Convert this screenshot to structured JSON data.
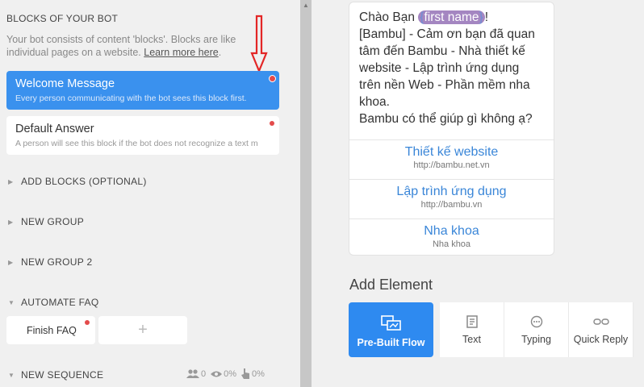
{
  "sidebar": {
    "title": "BLOCKS OF YOUR BOT",
    "description": "Your bot consists of content 'blocks'. Blocks are like individual pages on a website.",
    "learn_more": "Learn more here",
    "description_end": ".",
    "blocks": [
      {
        "title": "Welcome Message",
        "subtitle": "Every person communicating with the bot sees this block first."
      },
      {
        "title": "Default Answer",
        "subtitle": "A person will see this block if the bot does not recognize a text m"
      }
    ],
    "groups": [
      {
        "label": "ADD BLOCKS (OPTIONAL)"
      },
      {
        "label": "NEW GROUP"
      },
      {
        "label": "NEW GROUP 2"
      },
      {
        "label": "AUTOMATE FAQ"
      },
      {
        "label": "NEW SEQUENCE"
      }
    ],
    "faq_card": "Finish FAQ",
    "add_symbol": "+",
    "stats": {
      "users": "0",
      "views": "0%",
      "clicks": "0%"
    }
  },
  "message": {
    "greeting": "Chào Bạn ",
    "var_open": "{",
    "var_name": "first name",
    "var_close": "}",
    "greeting_end": "!",
    "body": "[Bambu] - Cảm ơn bạn đã quan tâm đến Bambu - Nhà thiết kế website - Lập trình ứng dụng trên nền Web - Phần mềm nha khoa.",
    "question": "Bambu có thể giúp gì không ạ?",
    "buttons": [
      {
        "title": "Thiết kế website",
        "url": "http://bambu.net.vn"
      },
      {
        "title": "Lập trình ứng dụng",
        "url": "http://bambu.vn"
      },
      {
        "title": "Nha khoa",
        "url": "Nha khoa"
      }
    ]
  },
  "add_element": {
    "title": "Add Element",
    "items": [
      {
        "label": "Pre-Built Flow",
        "icon": "flow-icon"
      },
      {
        "label": "Text",
        "icon": "text-icon"
      },
      {
        "label": "Typing",
        "icon": "typing-icon"
      },
      {
        "label": "Quick Reply",
        "icon": "quick-reply-icon"
      }
    ]
  },
  "colors": {
    "accent": "#3a91ee",
    "alert": "#e34b4b",
    "variable": "#a486c1"
  }
}
